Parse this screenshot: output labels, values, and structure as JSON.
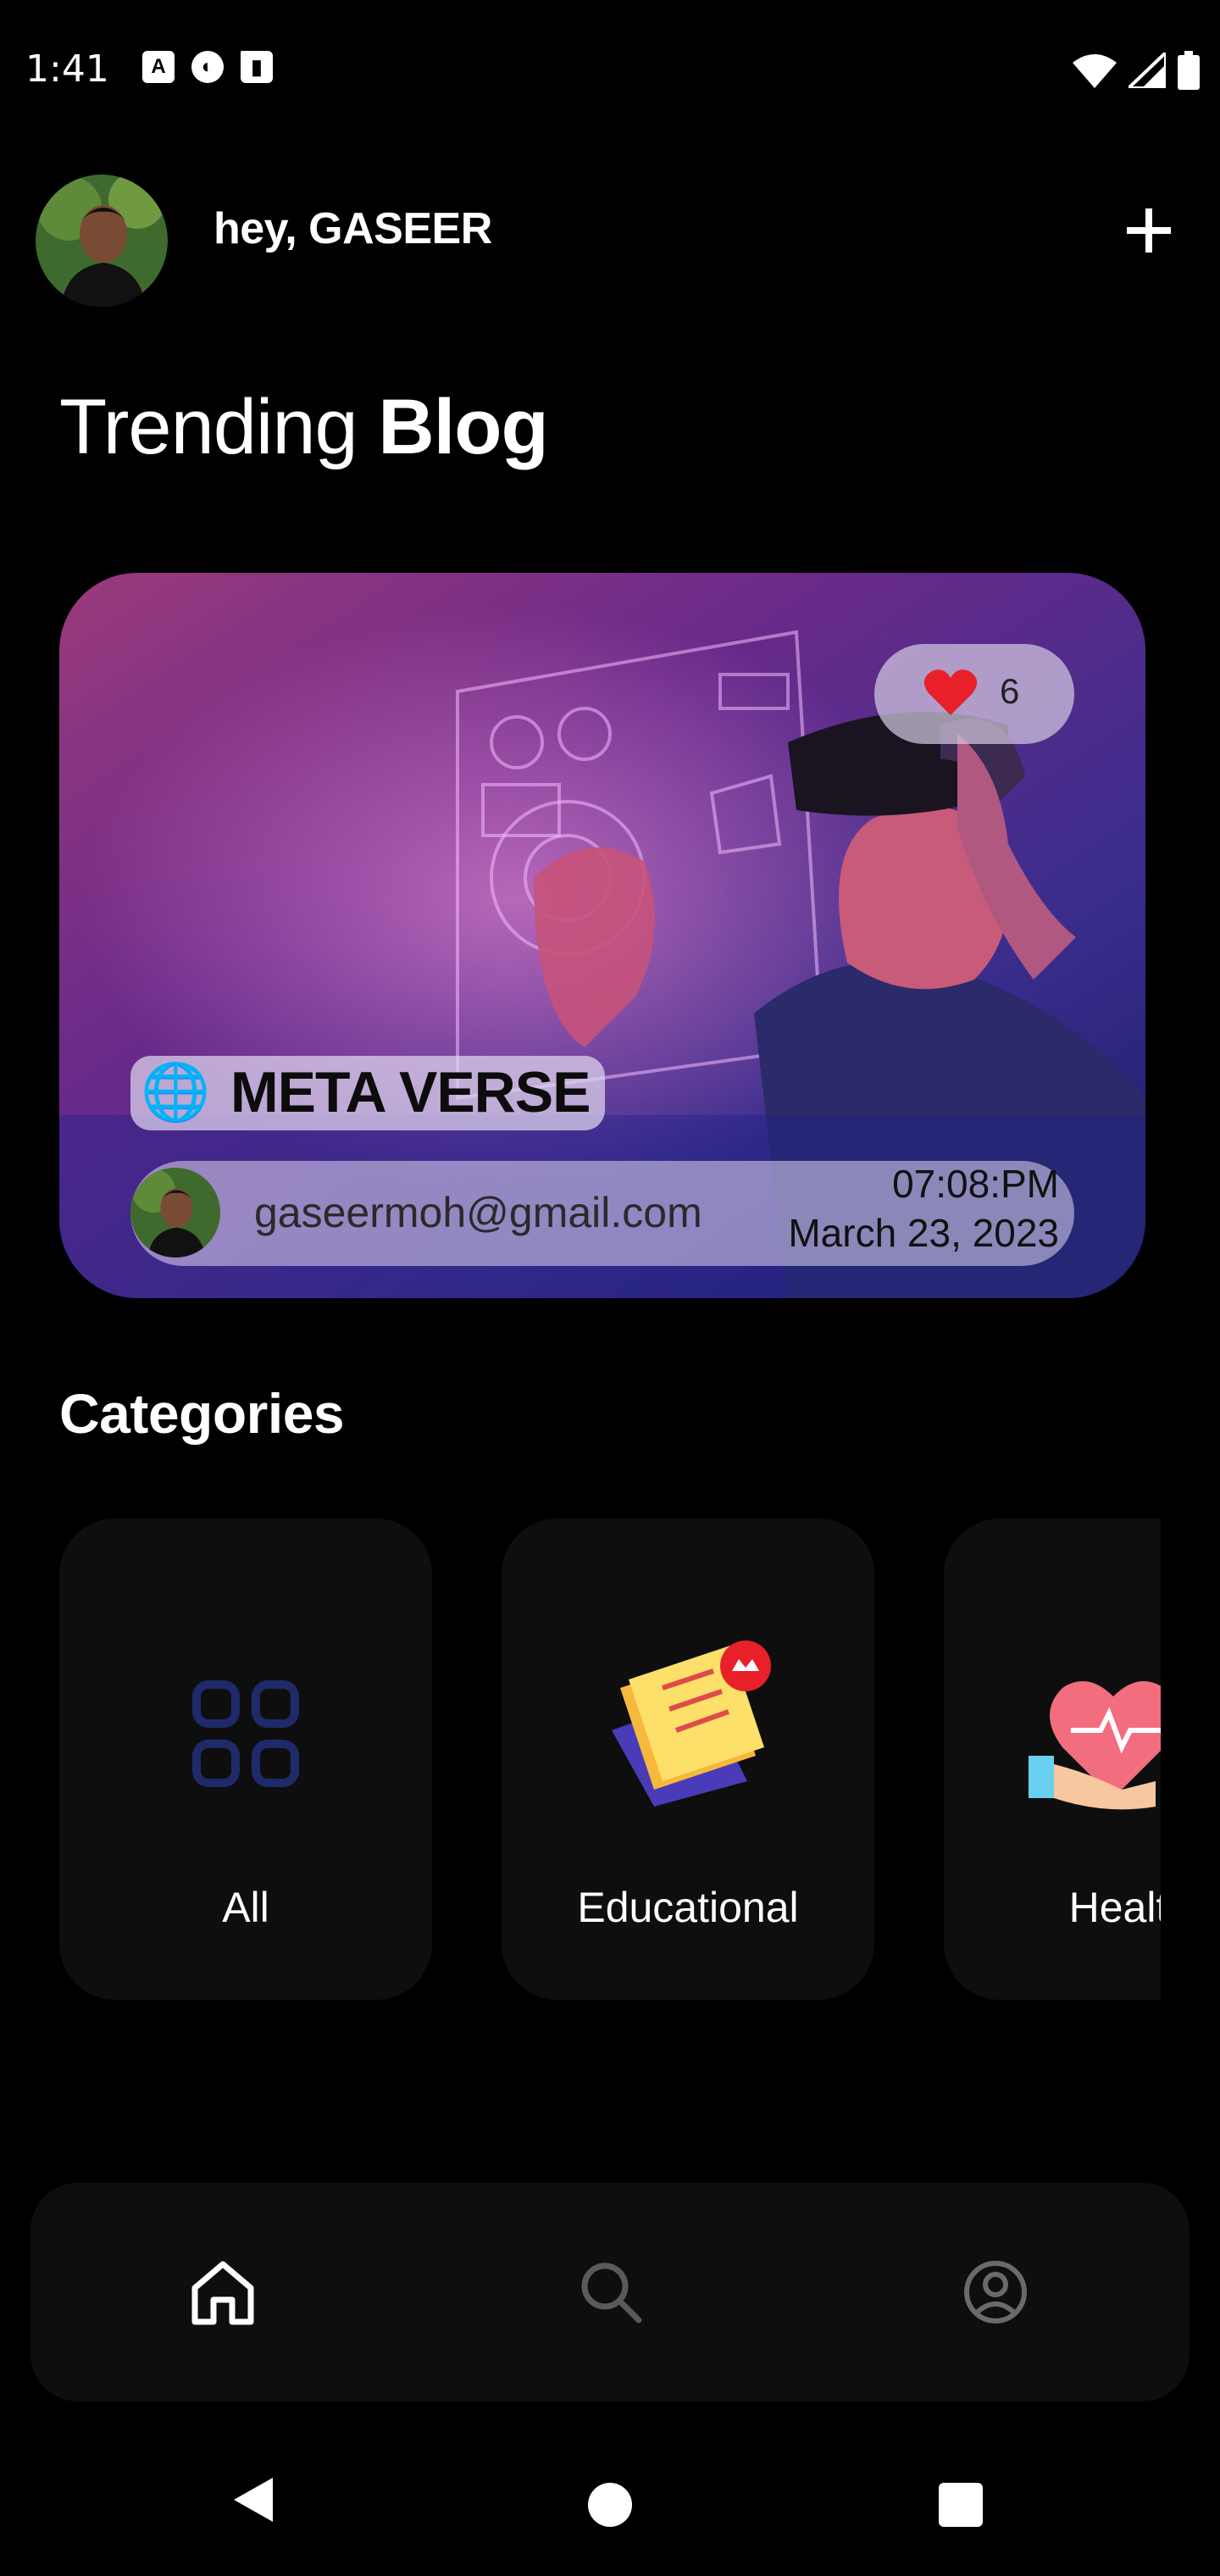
{
  "status_bar": {
    "time": "1:41",
    "left_icons": [
      "a-badge-icon",
      "sync-icon",
      "sd-card-icon"
    ],
    "right_icons": [
      "wifi-icon",
      "signal-icon",
      "battery-icon"
    ]
  },
  "header": {
    "greeting": "hey, GASEER",
    "add_icon": "plus-icon"
  },
  "trending": {
    "title_light": "Trending",
    "title_bold": "Blog",
    "post": {
      "likes": "6",
      "category_emoji": "🌐",
      "category": "META VERSE",
      "author_email": "gaseermoh@gmail.com",
      "time": "07:08:PM",
      "date": "March 23, 2023"
    }
  },
  "categories": {
    "heading": "Categories",
    "items": [
      {
        "label": "All",
        "icon": "grid-icon"
      },
      {
        "label": "Educational",
        "icon": "education-icon"
      },
      {
        "label": "Healt",
        "icon": "health-icon"
      }
    ]
  },
  "bottom_nav": {
    "items": [
      {
        "icon": "home-icon",
        "active": true
      },
      {
        "icon": "search-icon",
        "active": false
      },
      {
        "icon": "profile-icon",
        "active": false
      }
    ]
  },
  "system_nav": [
    "back-icon",
    "home-circle-icon",
    "recents-icon"
  ],
  "colors": {
    "background": "#000000",
    "card_surface": "#0e0e0e",
    "grid_icon": "#1f2a6b",
    "like_red": "#e8202a"
  }
}
